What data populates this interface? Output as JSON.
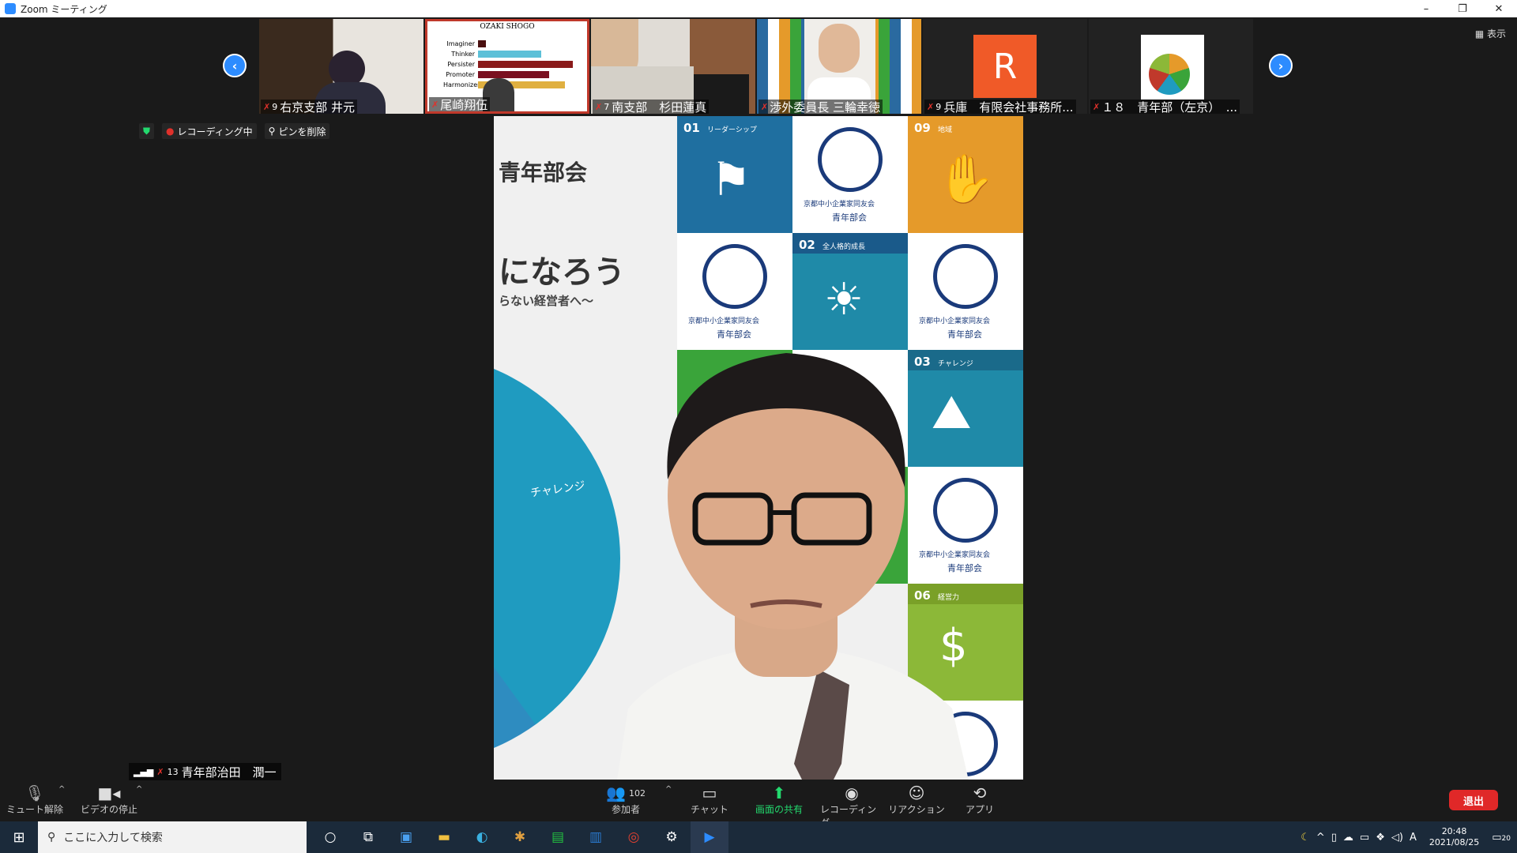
{
  "window": {
    "title": "Zoom ミーティング",
    "minimize": "–",
    "restore": "❐",
    "close": "✕"
  },
  "view_button": {
    "label": "▦ 表示"
  },
  "participants": [
    {
      "num": "9",
      "name": "右京支部 井元"
    },
    {
      "num": "",
      "name": "尾崎翔伍",
      "slide_title": "OZAKI SHOGO",
      "bars": [
        "Imaginer",
        "Thinker",
        "Persister",
        "Promoter",
        "Harmonizer"
      ]
    },
    {
      "num": "7",
      "name": "南支部　杉田蓮真"
    },
    {
      "num": "",
      "name": "渉外委員長 三輪幸徳"
    },
    {
      "num": "9",
      "name": "兵庫　有限会社事務所...",
      "avatar_letter": "R"
    },
    {
      "num": "",
      "name": "１８　青年部（左京）　..."
    }
  ],
  "status_bar": {
    "recording": "レコーディング中",
    "unpin": "ピンを削除"
  },
  "main_video": {
    "bg_text_1": "青年部会",
    "bg_text_2": "になろう",
    "bg_text_3": "らない経営者へ～",
    "cells": [
      {
        "num": "01",
        "label": "リーダーシップ",
        "color": "#1f6fa0"
      },
      {
        "num": "09",
        "label": "地域",
        "color": "#e59a2a"
      },
      {
        "num": "02",
        "label": "全人格的成長",
        "color": "#1f6fa0"
      },
      {
        "num": "03",
        "label": "チャレンジ",
        "color": "#1f8aa8"
      },
      {
        "num": "06",
        "label": "経営力",
        "color": "#8cb838"
      }
    ],
    "wheel_label": "チャレンジ",
    "org_name": "京都中小企業家同友会",
    "org_sub": "青年部会"
  },
  "self_view": {
    "num": "13",
    "name": "青年部治田　潤一"
  },
  "toolbar": {
    "unmute": "ミュート解除",
    "stop_video": "ビデオの停止",
    "participants": "参加者",
    "participants_count": "102",
    "chat": "チャット",
    "share": "画面の共有",
    "record": "レコーディング",
    "reactions": "リアクション",
    "apps": "アプリ",
    "exit": "退出"
  },
  "taskbar": {
    "search_placeholder": "ここに入力して検索",
    "time": "20:48",
    "date": "2021/08/25",
    "ime": "A",
    "notification_count": "20"
  }
}
